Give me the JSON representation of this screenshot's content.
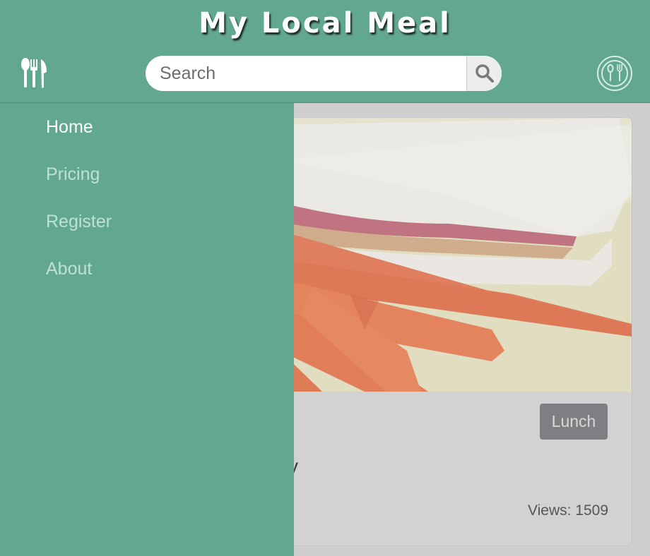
{
  "header": {
    "title": "My Local Meal",
    "menu_icon": "utensils-icon",
    "search": {
      "placeholder": "Search",
      "value": "",
      "icon": "search-icon"
    },
    "plate_icon": "plate-cutlery-icon"
  },
  "drawer": {
    "items": [
      {
        "label": "Home",
        "active": true
      },
      {
        "label": "Pricing",
        "active": false
      },
      {
        "label": "Register",
        "active": false
      },
      {
        "label": "About",
        "active": false
      }
    ]
  },
  "card": {
    "category": "Lunch",
    "title_fragment": "y",
    "views": "Views: 1509"
  },
  "colors": {
    "brand_green": "#62a88f",
    "overlay_gray": "#cfcfcf",
    "badge_gray": "#7d7f82"
  }
}
